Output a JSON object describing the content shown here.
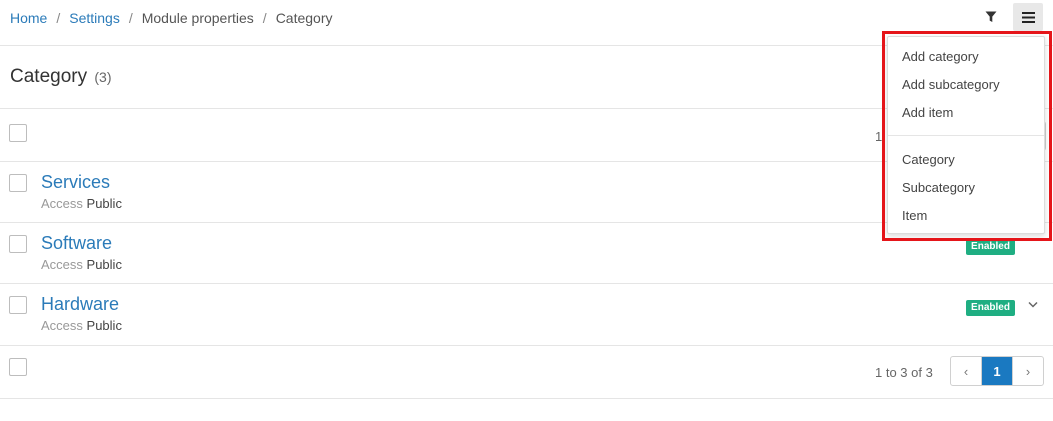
{
  "breadcrumb": {
    "home": "Home",
    "settings": "Settings",
    "module_properties": "Module properties",
    "current": "Category",
    "separator": "/"
  },
  "toolbar": {
    "filter_icon": "filter-icon",
    "menu_icon": "hamburger-menu-icon"
  },
  "page": {
    "title": "Category",
    "count": "(3)"
  },
  "rows": [
    {
      "title": "Services",
      "meta_label": "Access",
      "meta_value": "Public",
      "status": ""
    },
    {
      "title": "Software",
      "meta_label": "Access",
      "meta_value": "Public",
      "status": "Enabled"
    },
    {
      "title": "Hardware",
      "meta_label": "Access",
      "meta_value": "Public",
      "status": "Enabled"
    }
  ],
  "pagination": {
    "summary": "1 to 3 of 3",
    "partial_summary": "1",
    "prev": "‹",
    "current": "1",
    "next": "›"
  },
  "dropdown": {
    "add_items": [
      "Add category",
      "Add subcategory",
      "Add item"
    ],
    "view_items": [
      "Category",
      "Subcategory",
      "Item"
    ]
  },
  "colors": {
    "link": "#2b7bb9",
    "status_enabled": "#1fae82",
    "pager_active": "#1a79c1",
    "highlight": "#e5151a"
  }
}
